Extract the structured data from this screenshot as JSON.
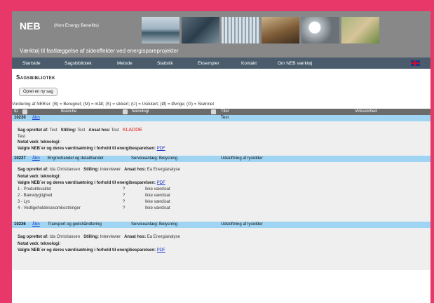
{
  "header": {
    "logo": "NEB",
    "subtitle": "(Non Energy Benefits)",
    "tagline": "Værktøj til fastlæggelse af sideeffekter ved energispareprojekter"
  },
  "nav": {
    "items": [
      "Startside",
      "Sagsbibliotek",
      "Metode",
      "Statistik",
      "Eksempler",
      "Kontakt",
      "Om NEB værktøj"
    ]
  },
  "page": {
    "title": "Sagsbibliotek",
    "new_case_button": "Opret en ny sag",
    "legend": "Vurdering af NEB'er: (B) = Beregnet; (M) = målt; (S) = sikkert; (U) = Usikkert; (Ø) = Øvrige; (G) = Skønnet"
  },
  "table": {
    "headers": [
      "ID",
      "Branche",
      "Teknologi",
      "Titel",
      "Virksomhed"
    ]
  },
  "labels": {
    "created_by": "Sag oprettet af:",
    "position": "Stilling:",
    "employed_at": "Ansat hos:",
    "tech_note": "Notat vedr. teknologi:",
    "chosen_neb": "Valgte NEB´er og deres værdisætning i forhold til energibesparelsen:",
    "pdf": "PDF",
    "open": "Åbn"
  },
  "cases": [
    {
      "id": "10230",
      "branche": "",
      "teknologi": "",
      "titel": "Test",
      "virksomhed": "",
      "created_by": "Test",
      "position": "Test",
      "employed_at": "Test",
      "status": "KLADDE",
      "extra": "Test",
      "nebs": []
    },
    {
      "id": "10227",
      "branche": "Engroshandel og detailhandel",
      "teknologi": "Serviceanlæg: Belysning",
      "titel": "Udskiftning af lyskilder",
      "virksomhed": "",
      "created_by": "Ida Christiansen",
      "position": "Interviewer",
      "employed_at": "Ea Energianalyse",
      "nebs": [
        {
          "name": "1 - Produktkvalitet",
          "mark": "?",
          "value": "Ikke værdisat"
        },
        {
          "name": "2 - Bæredygtighed",
          "mark": "?",
          "value": "Ikke værdisat"
        },
        {
          "name": "3 - Lys",
          "mark": "?",
          "value": "Ikke værdisat"
        },
        {
          "name": "4 - Vedligeholdelsesomkostninger",
          "mark": "?",
          "value": "Ikke værdisat"
        }
      ]
    },
    {
      "id": "10226",
      "branche": "Transport og godshåndtering",
      "teknologi": "Serviceanlæg: Belysning",
      "titel": "Udskiftning af lyskilder",
      "virksomhed": "",
      "created_by": "Ida Christiansen",
      "position": "Interviewer",
      "employed_at": "Ea Energianalyse",
      "nebs": []
    }
  ]
}
